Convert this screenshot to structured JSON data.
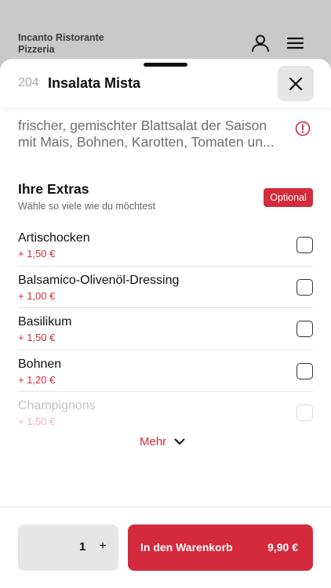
{
  "header": {
    "brand_name": "Incanto Ristorante Pizzeria",
    "user_icon": "user-icon",
    "menu_icon": "hamburger-menu-icon"
  },
  "item": {
    "number": "204",
    "name": "Insalata Mista",
    "description": "frischer, gemischter Blattsalat der Saison mit Mais, Bohnen, Karotten, Tomaten un..."
  },
  "extras": {
    "title": "Ihre Extras",
    "subtitle": "Wähle so viele wie du möchtest",
    "badge": "Optional",
    "items": [
      {
        "name": "Artischocken",
        "price": "+ 1,50 €"
      },
      {
        "name": "Balsamico-Olivenöl-Dressing",
        "price": "+ 1,00 €"
      },
      {
        "name": "Basilikum",
        "price": "+ 1,50 €"
      },
      {
        "name": "Bohnen",
        "price": "+ 1,20 €"
      },
      {
        "name": "Champignons",
        "price": "+ 1,50 €"
      }
    ],
    "more_label": "Mehr"
  },
  "footer": {
    "quantity": "1",
    "plus_label": "+",
    "cart_label": "In den Warenkorb",
    "cart_price": "9,90 €"
  },
  "colors": {
    "accent": "#d42a3c",
    "background_dim": "#c9c9c9"
  }
}
